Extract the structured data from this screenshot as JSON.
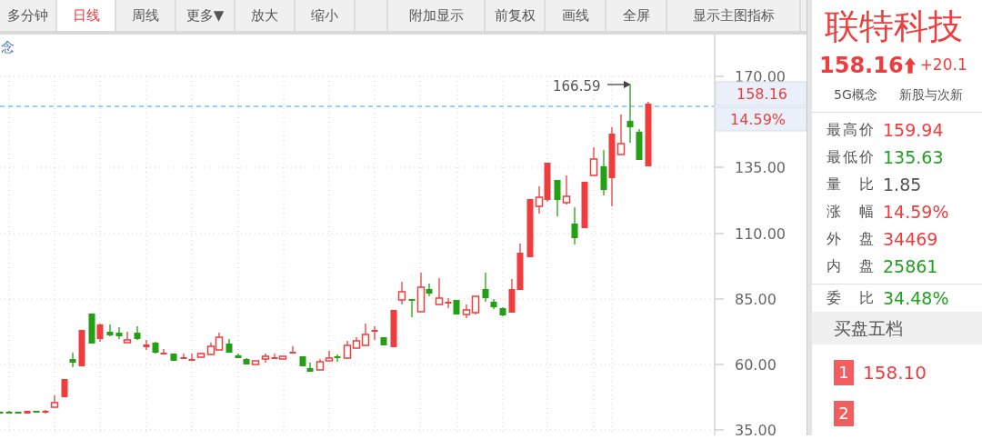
{
  "toolbar": {
    "buttons": [
      {
        "kind": "button",
        "label": "多分钟",
        "selected": false
      },
      {
        "kind": "button",
        "label": "日线",
        "selected": true
      },
      {
        "kind": "button",
        "label": "周线",
        "selected": false
      },
      {
        "kind": "button",
        "label": "更多▼",
        "selected": false
      },
      {
        "kind": "button",
        "label": "放大",
        "selected": false
      },
      {
        "kind": "button",
        "label": "缩小",
        "selected": false
      },
      {
        "kind": "spacer"
      },
      {
        "kind": "button",
        "label": "附加显示",
        "selected": false
      },
      {
        "kind": "button",
        "label": "前复权",
        "selected": false
      },
      {
        "kind": "button",
        "label": "画线",
        "selected": false
      },
      {
        "kind": "button",
        "label": "全屏",
        "selected": false
      },
      {
        "kind": "button",
        "label": "显示主图指标",
        "selected": false
      }
    ]
  },
  "chart": {
    "concept_label": "念",
    "high_marker": "166.59",
    "price_tag": "158.16",
    "change_tag": "14.59%",
    "axis_ticks": [
      "170.00",
      "135.00",
      "110.00",
      "85.00",
      "60.00",
      "35.00"
    ]
  },
  "quote": {
    "name": "联特科技",
    "price": "158.16",
    "up": true,
    "change": "+20.1",
    "tags": [
      "5G概念",
      "新股与次新"
    ],
    "stats": [
      {
        "label": "最高价",
        "value": "159.94",
        "color": "#f03c3c"
      },
      {
        "label": "最低价",
        "value": "135.63",
        "color": "#22a022"
      },
      {
        "label": "量 比",
        "value": "1.85",
        "color": "#555555"
      },
      {
        "label": "涨 幅",
        "value": "14.59%",
        "color": "#f03c3c"
      },
      {
        "label": "外 盘",
        "value": "34469",
        "color": "#f03c3c"
      },
      {
        "label": "内 盘",
        "value": "25861",
        "color": "#22a022"
      }
    ],
    "ratio": {
      "label": "委 比",
      "value": "34.48%",
      "color": "#22a022"
    },
    "bid_title": "买盘五档",
    "bids": [
      {
        "level": "1",
        "price": "158.10"
      },
      {
        "level": "2"
      }
    ]
  }
}
